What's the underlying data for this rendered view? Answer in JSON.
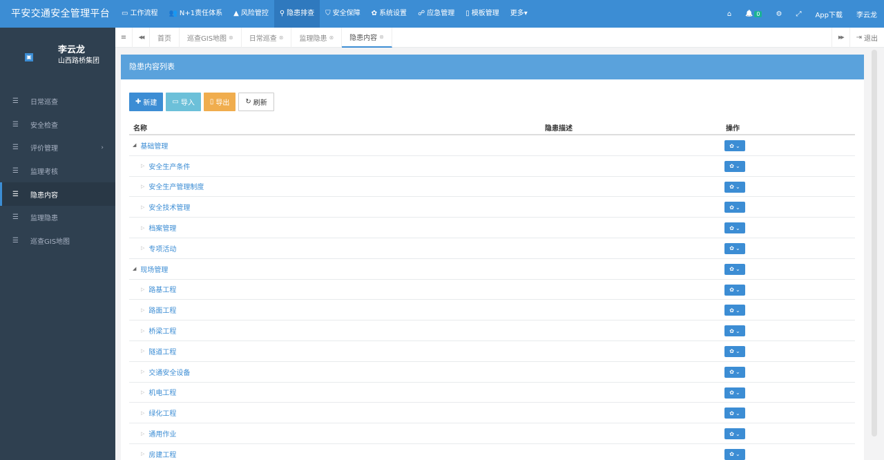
{
  "app": {
    "title": "平安交通安全管理平台"
  },
  "topnav": {
    "items": [
      {
        "icon": "monitor-icon",
        "glyph": "▭",
        "label": "工作流程"
      },
      {
        "icon": "users-icon",
        "glyph": "👥",
        "label": "N+1责任体系"
      },
      {
        "icon": "warning-icon",
        "glyph": "▲",
        "label": "风险管控"
      },
      {
        "icon": "search-icon",
        "glyph": "⚲",
        "label": "隐患排查",
        "active": true
      },
      {
        "icon": "shield-icon",
        "glyph": "⛉",
        "label": "安全保障"
      },
      {
        "icon": "gear-icon",
        "glyph": "✿",
        "label": "系统设置"
      },
      {
        "icon": "emergency-icon",
        "glyph": "☍",
        "label": "应急管理"
      },
      {
        "icon": "file-icon",
        "glyph": "▯",
        "label": "模板管理"
      },
      {
        "icon": "more-icon",
        "glyph": "",
        "label": "更多▾"
      }
    ],
    "right": {
      "home_glyph": "⌂",
      "bell_glyph": "🔔",
      "notif_count": "0",
      "settings_glyph": "⚙",
      "fullscreen_glyph": "⤢",
      "app_download": "App下载",
      "user": "李云龙"
    }
  },
  "sidebar": {
    "user_name": "李云龙",
    "org": "山西路桥集团",
    "items": [
      {
        "label": "日常巡查"
      },
      {
        "label": "安全检查"
      },
      {
        "label": "评价管理",
        "arrow": "›"
      },
      {
        "label": "监理考核"
      },
      {
        "label": "隐患内容",
        "active": true
      },
      {
        "label": "监理隐患"
      },
      {
        "label": "巡查GIS地图"
      }
    ]
  },
  "tabs": {
    "menu_glyph": "≡",
    "back_glyph": "◀◀",
    "items": [
      {
        "label": "首页",
        "closable": false
      },
      {
        "label": "巡查GIS地图",
        "closable": true
      },
      {
        "label": "日常巡查",
        "closable": true
      },
      {
        "label": "监理隐患",
        "closable": true
      },
      {
        "label": "隐患内容",
        "closable": true,
        "active": true
      }
    ],
    "close_glyph": "⊗",
    "forward_glyph": "▶▶",
    "logout_label": "退出"
  },
  "panel": {
    "title": "隐患内容列表",
    "toolbar": {
      "new_label": "新建",
      "import_label": "导入",
      "export_label": "导出",
      "refresh_label": "刷新"
    },
    "columns": {
      "name": "名称",
      "desc": "隐患描述",
      "ops": "操作"
    },
    "rows": [
      {
        "name": "基础管理",
        "level": 0
      },
      {
        "name": "安全生产条件",
        "level": 1
      },
      {
        "name": "安全生产管理制度",
        "level": 1
      },
      {
        "name": "安全技术管理",
        "level": 1
      },
      {
        "name": "档案管理",
        "level": 1
      },
      {
        "name": "专项活动",
        "level": 1
      },
      {
        "name": "现场管理",
        "level": 0
      },
      {
        "name": "路基工程",
        "level": 1
      },
      {
        "name": "路面工程",
        "level": 1
      },
      {
        "name": "桥梁工程",
        "level": 1
      },
      {
        "name": "隧道工程",
        "level": 1
      },
      {
        "name": "交通安全设备",
        "level": 1
      },
      {
        "name": "机电工程",
        "level": 1
      },
      {
        "name": "绿化工程",
        "level": 1
      },
      {
        "name": "通用作业",
        "level": 1
      },
      {
        "name": "房建工程",
        "level": 1
      }
    ]
  },
  "colors": {
    "primary": "#3c8dd4",
    "sidebar": "#2f4050",
    "panel_header": "#5aa2dc",
    "warning": "#f0ad4e",
    "info": "#6cc0d9"
  }
}
